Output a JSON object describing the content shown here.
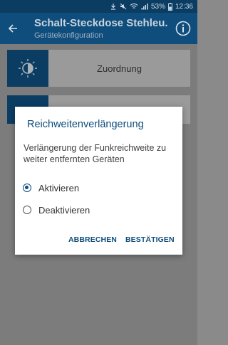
{
  "status_bar": {
    "battery_percent": "53%",
    "time": "12:36",
    "icons": [
      "download-icon",
      "mute-icon",
      "wifi-icon",
      "signal-icon",
      "battery-icon"
    ]
  },
  "app_bar": {
    "title": "Schalt-Steckdose Stehleu...",
    "subtitle": "Gerätekonfiguration",
    "back_icon": "arrow-left-icon",
    "info_icon": "info-icon"
  },
  "content": {
    "rows": [
      {
        "label": "Zuordnung",
        "icon": "light-dimmer-icon"
      },
      {
        "label": "",
        "icon": "row-icon"
      }
    ]
  },
  "dialog": {
    "title": "Reichweitenverlängerung",
    "message": "Verlängerung der Funkreichweite zu weiter entfernten Geräten",
    "options": [
      {
        "label": "Aktivieren",
        "selected": true
      },
      {
        "label": "Deaktivieren",
        "selected": false
      }
    ],
    "cancel_label": "ABBRECHEN",
    "confirm_label": "BESTÄTIGEN"
  },
  "colors": {
    "primary": "#0e4d7c",
    "status_bar": "#0b3d63",
    "scrim": "#7c7c7c"
  }
}
